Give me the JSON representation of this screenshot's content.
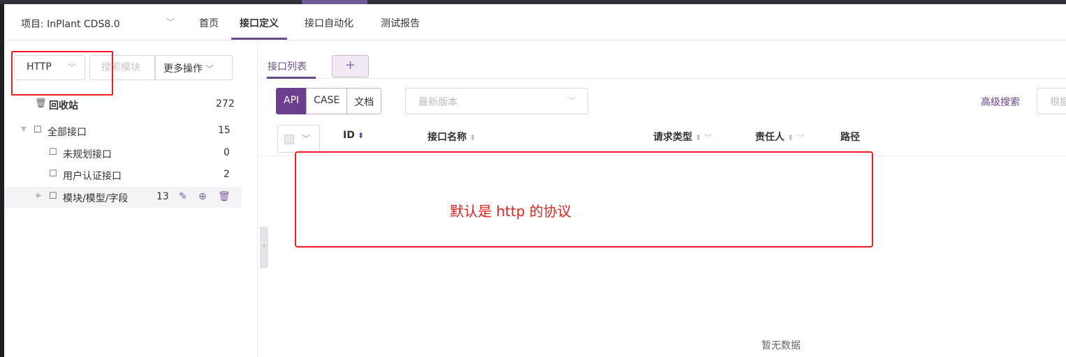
{
  "header": {
    "project_label": "项目: InPlant CDS8.0",
    "tabs": [
      {
        "label": "首页"
      },
      {
        "label": "接口定义"
      },
      {
        "label": "接口自动化"
      },
      {
        "label": "测试报告"
      }
    ],
    "active_tab": "接口定义"
  },
  "sidebar": {
    "protocol_select": "HTTP",
    "search_placeholder": "搜索模块",
    "more_actions_label": "更多操作",
    "recycle": {
      "label": "回收站",
      "count": "272"
    },
    "tree": [
      {
        "label": "全部接口",
        "count": "15"
      },
      {
        "label": "未规划接口",
        "count": "0"
      },
      {
        "label": "用户认证接口",
        "count": "2"
      },
      {
        "label": "模块/模型/字段",
        "count": "13"
      }
    ]
  },
  "main": {
    "subtab_label": "接口列表",
    "add_tab_label": "+",
    "segments": [
      "API",
      "CASE",
      "文档"
    ],
    "version_placeholder": "最新版本",
    "advanced_search_label": "高级搜索",
    "search_placeholder": "根据",
    "columns": [
      "ID",
      "接口名称",
      "请求类型",
      "责任人",
      "路径"
    ],
    "empty_text": "暂无数据"
  },
  "annotation": {
    "text": "默认是 http 的协议"
  },
  "colors": {
    "accent": "#6b3f8e",
    "annotation_red": "#ee1c24"
  }
}
